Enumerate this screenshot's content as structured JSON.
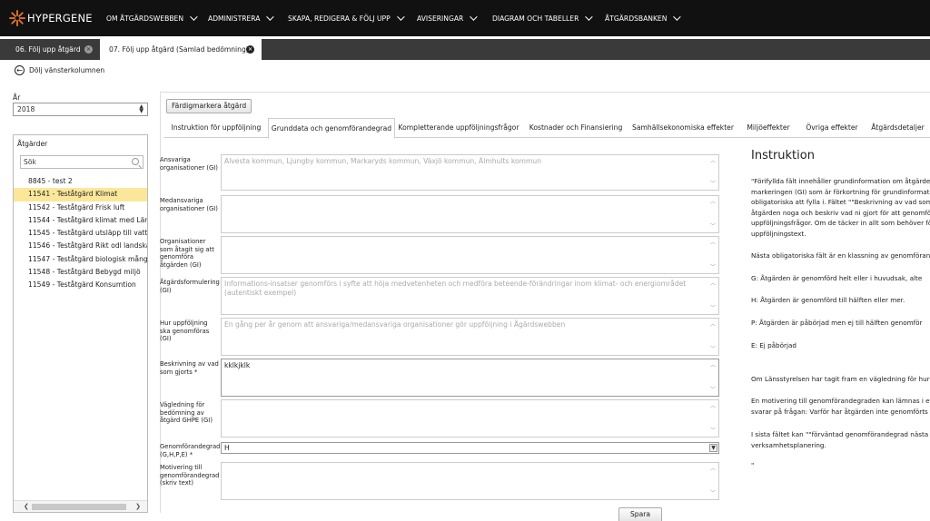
{
  "brand": {
    "name": "HYPERGENE",
    "color": "#e8792b"
  },
  "nav": [
    {
      "label": "OM ÅTGÄRDSWEBBEN"
    },
    {
      "label": "ADMINISTRERA"
    },
    {
      "label": "SKAPA, REDIGERA & FÖLJ UPP"
    },
    {
      "label": "AVISERINGAR"
    },
    {
      "label": "DIAGRAM OCH TABELLER"
    },
    {
      "label": "ÅTGÄRDSBANKEN"
    }
  ],
  "window_tabs": [
    {
      "label": "06. Följ upp åtgärd",
      "active": false
    },
    {
      "label": "07. Följ upp åtgärd (Samlad bedömning)",
      "active": true
    }
  ],
  "hide_left": {
    "label": "Dölj vänsterkolumnen"
  },
  "sidebar": {
    "year_label": "År",
    "year_value": "2018",
    "actions_title": "Åtgärder",
    "search_placeholder": "Sök",
    "items": [
      {
        "label": "8845 - test 2"
      },
      {
        "label": "11541 - Teståtgärd Klimat",
        "selected": true
      },
      {
        "label": "11542 - Teståtgärd Frisk luft"
      },
      {
        "label": "11544 - Teståtgärd klimat med Länsst"
      },
      {
        "label": "11545 - Teståtgärd utsläpp till vatten"
      },
      {
        "label": "11546 - Teståtgärd Rikt odl landskap"
      },
      {
        "label": "11547 - Teståtgärd biologisk mångfald"
      },
      {
        "label": "11548 - Teståtgärd Bebygd miljö"
      },
      {
        "label": "11549 - Teståtgärd Konsumtion"
      }
    ]
  },
  "main": {
    "mark_button": "Färdigmarkera åtgärd",
    "tabs": [
      {
        "label": "Instruktion för uppföljning"
      },
      {
        "label": "Grunddata och genomförandegrad",
        "active": true
      },
      {
        "label": "Kompletterande uppföljningsfrågor"
      },
      {
        "label": "Kostnader och Finansiering"
      },
      {
        "label": "Samhällsekonomiska effekter"
      },
      {
        "label": "Miljöeffekter"
      },
      {
        "label": "Övriga effekter"
      },
      {
        "label": "Åtgärdsdetaljer"
      }
    ],
    "fields": [
      {
        "label": "Ansvariga organisationer (GI)",
        "value": "Alvesta kommun, Ljungby kommun, Markaryds kommun, Växjö kommun, Älmhults kommun"
      },
      {
        "label": "Medansvariga organisationer (GI)",
        "value": ""
      },
      {
        "label": "Organisationer som åtagit sig att genomföra åtgärden (GI)",
        "value": ""
      },
      {
        "label": "Åtgärdsformulering (GI)",
        "value": "Informations-insatser genomförs i syfte att höja medvetenheten och medföra beteende-förändringar inom klimat- och energiområdet (autentiskt exempel)"
      },
      {
        "label": "Hur uppföljning ska genomföras (GI)",
        "value": "En gång per år genom att ansvariga/medansvariga organisationer gör uppföljning i Ågärdswebben"
      },
      {
        "label": "Beskrivning av vad som gjorts *",
        "value": "kklkjklk"
      },
      {
        "label": "Vägledning för bedömning av åtgärd GHPE (GI)",
        "value": ""
      },
      {
        "label": "Genomförandegrad (G,H,P,E) *",
        "value": "H"
      },
      {
        "label": "Motivering till genomförandegrad (skriv text)",
        "value": ""
      }
    ],
    "save_button": "Spara"
  },
  "instruction": {
    "title": "Instruktion",
    "lines": [
      "\"Förifyllda fält innehåller grundinformation om åtgärden",
      "markeringen (GI) som är förkortning för grundinformatio",
      "obligatoriska att fylla i. Fältet \"\"Beskrivning av vad som g",
      "åtgärden noga och beskriv vad ni gjort för att genomföra",
      "uppföljningsfrågor. Om de täcker in allt som behöver föl",
      "uppföljningstext.",
      "Nästa obligatoriska fält är en klassning av genomförande",
      "G: Åtgärden är genomförd helt eller i huvudsak, alte",
      "H: Åtgärden är genomförd till hälften eller mer.",
      "P: Åtgärden är påbörjad men ej till hälften genomför",
      "E: Ej påbörjad",
      "Om Länsstyrelsen har tagit fram en vägledning för hur kl",
      "En motivering till genomförandegraden kan lämnas i ett",
      "svarar på frågan: Varför har åtgärden inte genomförts al",
      "I sista fältet kan \"\"förväntad genomförandegrad nästa år\"",
      "verksamhetsplanering.",
      "\""
    ]
  }
}
